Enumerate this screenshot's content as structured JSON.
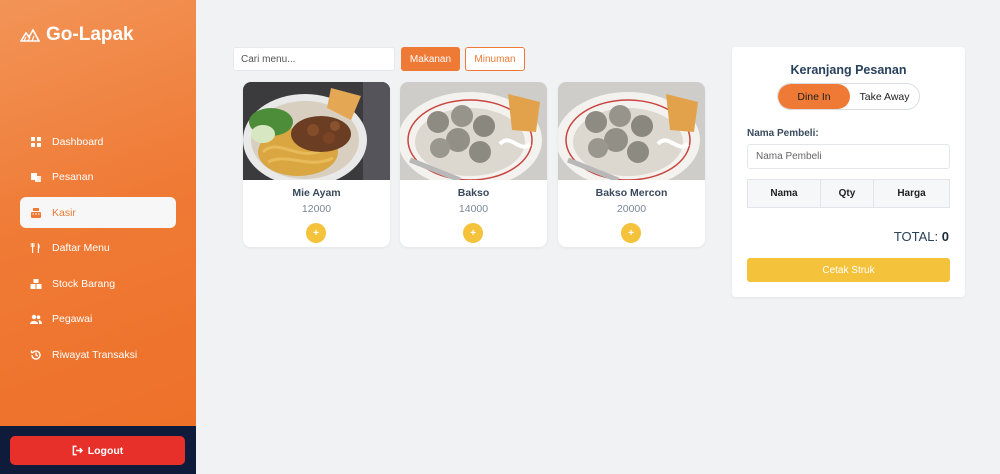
{
  "brand": {
    "name": "Go-Lapak"
  },
  "sidebar": {
    "items": [
      {
        "label": "Dashboard",
        "icon": "grid-icon",
        "active": false
      },
      {
        "label": "Pesanan",
        "icon": "receipt-icon",
        "active": false
      },
      {
        "label": "Kasir",
        "icon": "cash-register-icon",
        "active": true
      },
      {
        "label": "Daftar Menu",
        "icon": "utensils-icon",
        "active": false
      },
      {
        "label": "Stock Barang",
        "icon": "boxes-icon",
        "active": false
      },
      {
        "label": "Pegawai",
        "icon": "users-icon",
        "active": false
      },
      {
        "label": "Riwayat Transaksi",
        "icon": "history-icon",
        "active": false
      }
    ],
    "logout_label": "Logout"
  },
  "toolbar": {
    "search_placeholder": "Cari menu...",
    "tab_food": "Makanan",
    "tab_drink": "Minuman"
  },
  "menu": [
    {
      "name": "Mie Ayam",
      "price": "12000",
      "add_label": "+"
    },
    {
      "name": "Bakso",
      "price": "14000",
      "add_label": "+"
    },
    {
      "name": "Bakso Mercon",
      "price": "20000",
      "add_label": "+"
    }
  ],
  "cart": {
    "title": "Keranjang Pesanan",
    "mode_dine_in": "Dine In",
    "mode_take_away": "Take Away",
    "buyer_label": "Nama Pembeli:",
    "buyer_placeholder": "Nama Pembeli",
    "columns": [
      "Nama",
      "Qty",
      "Harga"
    ],
    "total_label": "TOTAL:",
    "total_value": "0",
    "print_label": "Cetak Struk"
  },
  "colors": {
    "accent": "#ee7a35",
    "yellow": "#f5c23c",
    "logout_red": "#e8302b",
    "navy": "#0f1b3a"
  }
}
